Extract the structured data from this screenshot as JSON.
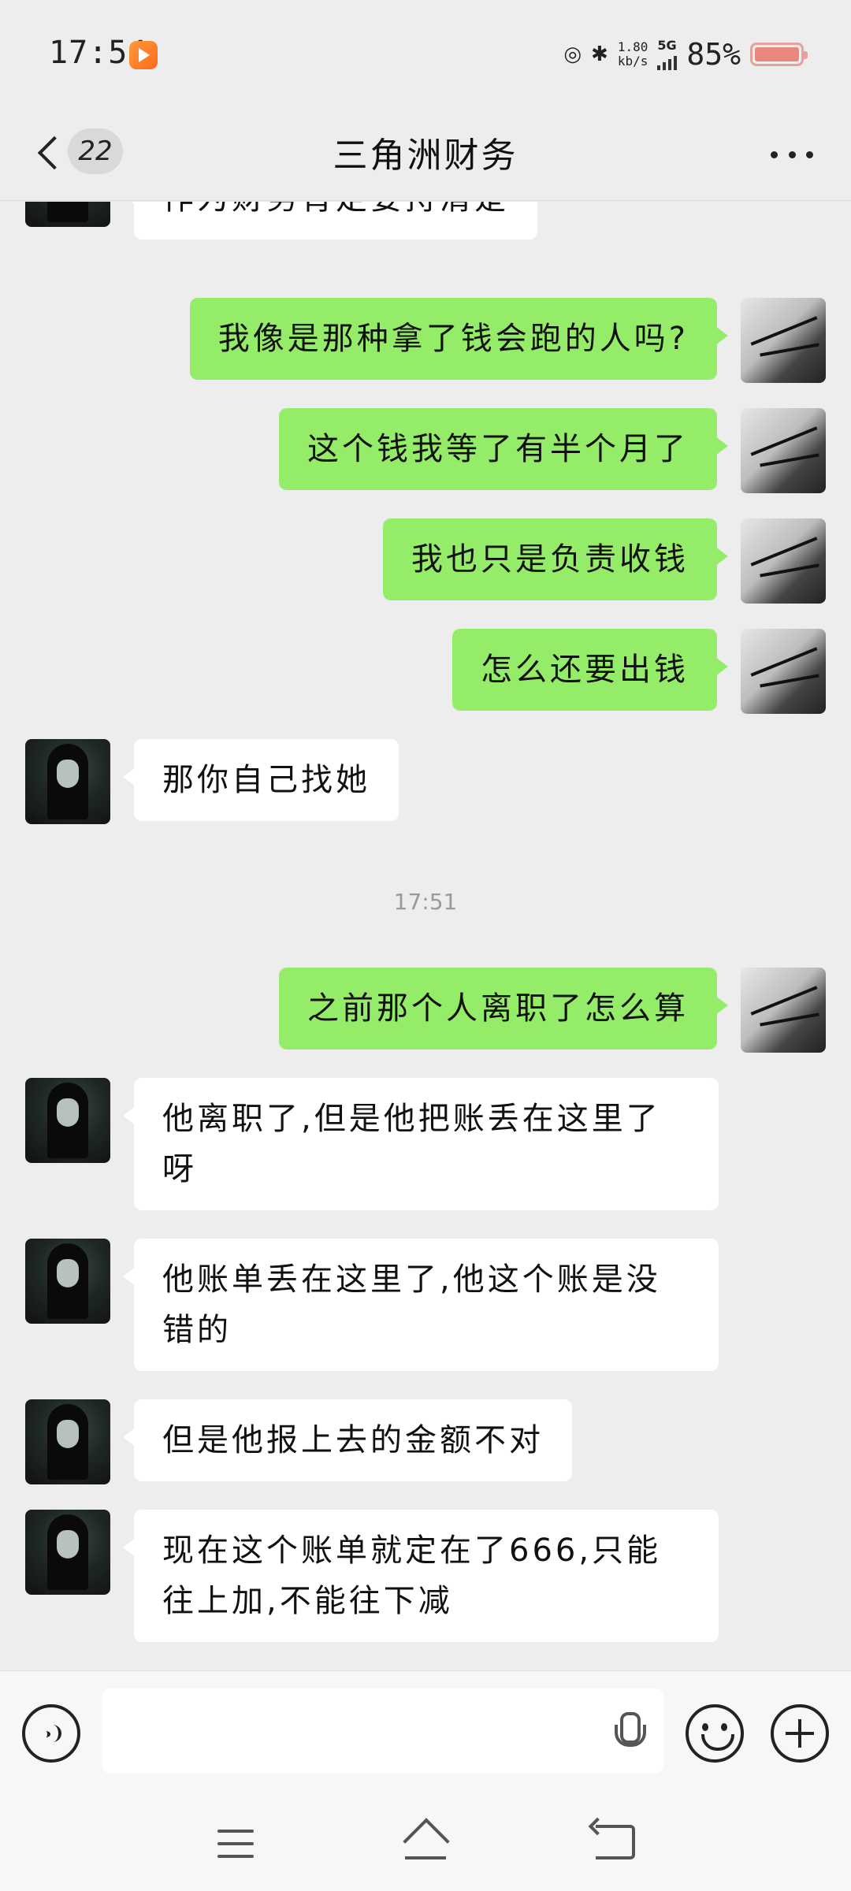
{
  "status_bar": {
    "time": "17:54",
    "net_speed_value": "1.80",
    "net_speed_unit": "kb/s",
    "network": "5G",
    "battery": "85%"
  },
  "header": {
    "badge_count": "22",
    "title": "三角洲财务"
  },
  "messages": [
    {
      "side": "left",
      "text": "作为财务肯定要捋清楚"
    },
    {
      "side": "right",
      "text": "我像是那种拿了钱会跑的人吗?"
    },
    {
      "side": "right",
      "text": "这个钱我等了有半个月了"
    },
    {
      "side": "right",
      "text": "我也只是负责收钱"
    },
    {
      "side": "right",
      "text": "怎么还要出钱"
    },
    {
      "side": "left",
      "text": "那你自己找她"
    },
    {
      "side": "right",
      "text": "之前那个人离职了怎么算"
    },
    {
      "side": "left",
      "text": "他离职了,但是他把账丢在这里了呀"
    },
    {
      "side": "left",
      "text": "他账单丢在这里了,他这个账是没错的"
    },
    {
      "side": "left",
      "text": "但是他报上去的金额不对"
    },
    {
      "side": "left",
      "text": "现在这个账单就定在了666,只能往上加,不能往下减"
    }
  ],
  "timestamp": "17:51",
  "input": {
    "value": ""
  },
  "icons": {
    "back": "chevron-left-icon",
    "more": "more-dots-icon",
    "voice": "voice-icon",
    "mic": "mic-icon",
    "emoji": "emoji-icon",
    "plus": "plus-icon"
  },
  "colors": {
    "sent_bubble": "#95ec69",
    "received_bubble": "#ffffff",
    "background": "#ededed"
  }
}
